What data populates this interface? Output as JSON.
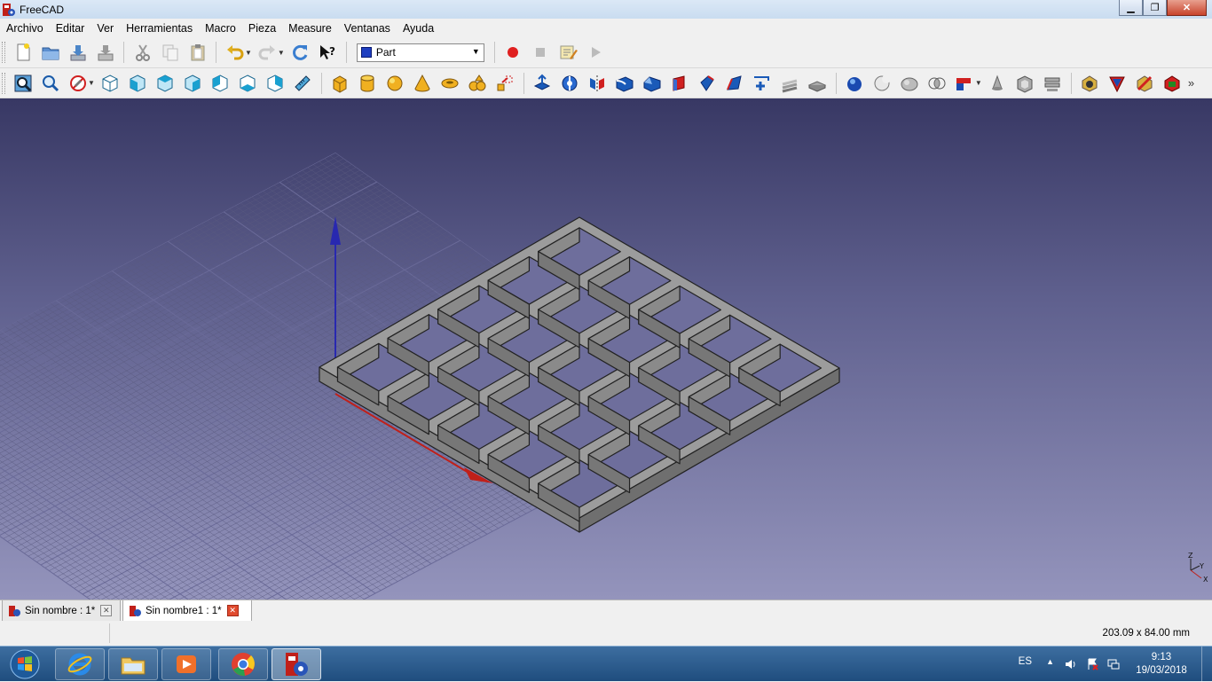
{
  "window": {
    "title": "FreeCAD",
    "min_glyph": "▁",
    "max_glyph": "❐",
    "close_glyph": "✕"
  },
  "menu": [
    "Archivo",
    "Editar",
    "Ver",
    "Herramientas",
    "Macro",
    "Pieza",
    "Measure",
    "Ventanas",
    "Ayuda"
  ],
  "toolbar1": {
    "icons": [
      "new-file-icon",
      "open-file-icon",
      "save-icon",
      "save-as-icon",
      "cut-icon",
      "copy-icon",
      "paste-icon",
      "undo-icon",
      "redo-icon",
      "refresh-icon",
      "whats-this-icon"
    ],
    "workbench": "Part",
    "macro": [
      "macro-record-icon",
      "macro-stop-icon",
      "macro-edit-icon",
      "macro-run-icon"
    ]
  },
  "toolbar2": {
    "view": [
      "fit-all-icon",
      "fit-selection-icon",
      "draw-style-icon",
      "isometric-view-icon",
      "front-view-icon",
      "top-view-icon",
      "right-view-icon",
      "rear-view-icon",
      "bottom-view-icon",
      "left-view-icon",
      "measure-distance-icon"
    ],
    "primitives": [
      "cube-icon",
      "cylinder-icon",
      "sphere-icon",
      "cone-icon",
      "torus-icon",
      "create-primitives-icon",
      "shape-builder-icon"
    ],
    "tools": [
      "extrude-icon",
      "revolve-icon",
      "mirror-icon",
      "fillet-icon",
      "chamfer-icon",
      "make-face-icon",
      "ruled-surface-icon",
      "loft-icon",
      "sweep-icon",
      "section-icon",
      "cross-sections-icon",
      "offset-icon"
    ],
    "booleans": [
      "boolean-icon",
      "cut-boolean-icon",
      "fuse-icon",
      "common-icon",
      "compound-icon",
      "check-geometry-icon",
      "thickness-icon",
      "project-icon",
      "measure-linear-icon",
      "measure-angular-icon",
      "clear-measure-icon",
      "toggle-3d-icon"
    ],
    "overflow": "»"
  },
  "doc_tabs": [
    {
      "label": "Sin nombre : 1*",
      "active": false
    },
    {
      "label": "Sin nombre1 : 1*",
      "active": true
    }
  ],
  "status": {
    "dimensions": "203.09 x 84.00 mm"
  },
  "axis_labels": {
    "z": "Z",
    "y": "Y",
    "x": "X"
  },
  "taskbar": {
    "apps": [
      "start-button",
      "internet-explorer-icon",
      "file-explorer-icon",
      "media-player-icon",
      "chrome-icon",
      "freecad-icon"
    ],
    "tray": {
      "lang": "ES",
      "time": "9:13",
      "date": "19/03/2018",
      "up_arrow": "▲"
    }
  },
  "colors": {
    "grid": "#5a5a80",
    "part_top": "#9c9c9c",
    "part_front": "#828282",
    "part_side": "#6f6f6f",
    "x_axis": "#c0201a",
    "y_axis": "#1a9a1a",
    "z_axis": "#2828b0"
  }
}
